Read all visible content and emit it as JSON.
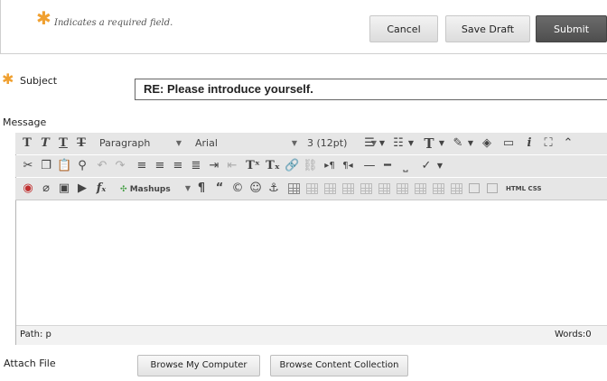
{
  "header": {
    "required_mark": "✱",
    "required_note": "Indicates a required field.",
    "cancel_label": "Cancel",
    "save_draft_label": "Save Draft",
    "submit_label": "Submit"
  },
  "subject": {
    "required_mark": "✱",
    "label": "Subject",
    "value": "RE: Please introduce yourself."
  },
  "message": {
    "label": "Message",
    "toolbar": {
      "paragraph_select": "Paragraph",
      "font_select": "Arial",
      "size_select": "3 (12pt)",
      "mashups_label": "Mashups",
      "html_label": "HTML",
      "css_label": "CSS"
    },
    "path_label": "Path: p",
    "words_label": "Words:0"
  },
  "attach": {
    "label": "Attach File",
    "browse_computer_label": "Browse My Computer",
    "browse_collection_label": "Browse Content Collection"
  },
  "colors": {
    "required_star": "#f0a030",
    "submit_bg": "#555555",
    "toolbar_bg": "#e6e6e6"
  }
}
